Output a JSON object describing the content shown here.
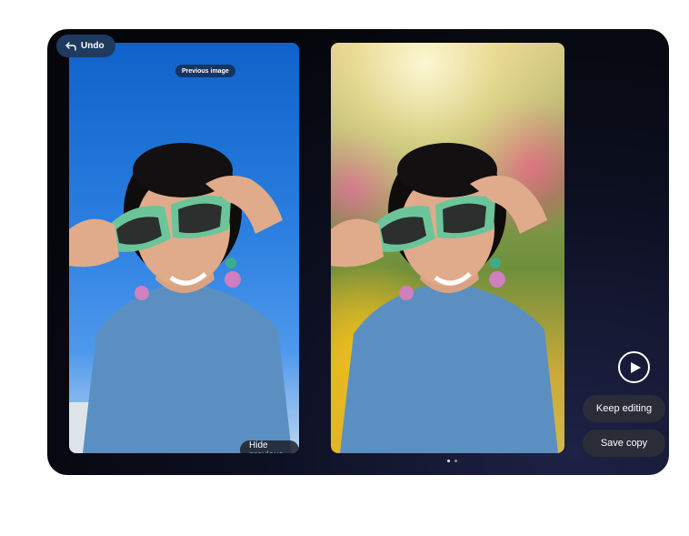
{
  "toolbar": {
    "undo_label": "Undo",
    "undo_icon": "undo-arrow-icon"
  },
  "previous_image": {
    "label": "Previous image",
    "hide_label": "Hide previous"
  },
  "actions": {
    "play_icon": "play-icon",
    "keep_editing_label": "Keep editing",
    "save_copy_label": "Save copy"
  },
  "pager": {
    "count": 2,
    "active_index": 0
  },
  "colors": {
    "background": "#0c0f1f",
    "button": "#2a2d38",
    "undo_button": "#1e3a5f",
    "sky": "#2a7fe0",
    "shirt": "#5b8fc2",
    "sunglasses": "#6cc59a"
  }
}
